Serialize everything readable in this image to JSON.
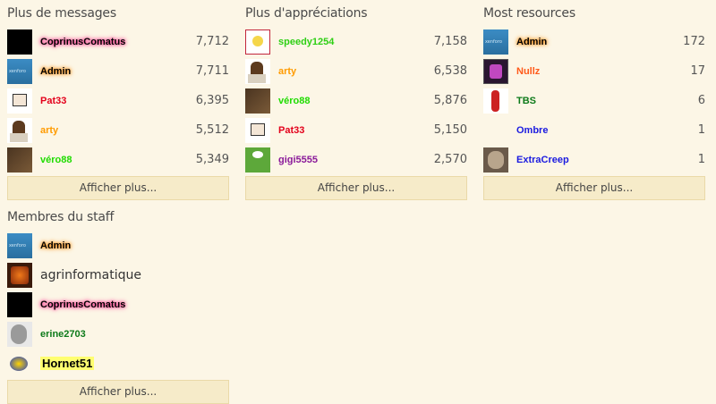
{
  "messages": {
    "title": "Plus de messages",
    "more_label": "Afficher plus...",
    "rows": [
      {
        "name": "CoprinusComatus",
        "count": "7,712",
        "avatar": "black-square-avatar"
      },
      {
        "name": "Admin",
        "count": "7,711",
        "avatar": "xenforo-avatar"
      },
      {
        "name": "Pat33",
        "count": "6,395",
        "avatar": "drawing-avatar"
      },
      {
        "name": "arty",
        "count": "5,512",
        "avatar": "cartoon-avatar"
      },
      {
        "name": "véro88",
        "count": "5,349",
        "avatar": "photo-avatar"
      }
    ]
  },
  "likes": {
    "title": "Plus d'appréciations",
    "more_label": "Afficher plus...",
    "rows": [
      {
        "name": "speedy1254",
        "count": "7,158",
        "avatar": "flower-avatar"
      },
      {
        "name": "arty",
        "count": "6,538",
        "avatar": "cartoon-avatar"
      },
      {
        "name": "véro88",
        "count": "5,876",
        "avatar": "photo-avatar"
      },
      {
        "name": "Pat33",
        "count": "5,150",
        "avatar": "drawing-avatar"
      },
      {
        "name": "gigi5555",
        "count": "2,570",
        "avatar": "comic-avatar"
      }
    ]
  },
  "resources": {
    "title": "Most resources",
    "more_label": "Afficher plus...",
    "rows": [
      {
        "name": "Admin",
        "count": "172",
        "avatar": "xenforo-avatar"
      },
      {
        "name": "Nullz",
        "count": "17",
        "avatar": "purple-avatar"
      },
      {
        "name": "TBS",
        "count": "6",
        "avatar": "figure-avatar"
      },
      {
        "name": "Ombre",
        "count": "1",
        "avatar": "empty-avatar"
      },
      {
        "name": "ExtraCreep",
        "count": "1",
        "avatar": "cat-avatar"
      }
    ]
  },
  "staff": {
    "title": "Membres du staff",
    "more_label": "Afficher plus...",
    "rows": [
      {
        "name": "Admin",
        "avatar": "xenforo-avatar"
      },
      {
        "name": "agrinformatique",
        "avatar": "orange-logo-avatar"
      },
      {
        "name": "CoprinusComatus",
        "avatar": "black-square-avatar"
      },
      {
        "name": "erine2703",
        "avatar": "portrait-avatar"
      },
      {
        "name": "Hornet51",
        "avatar": "hornet-avatar"
      }
    ]
  }
}
